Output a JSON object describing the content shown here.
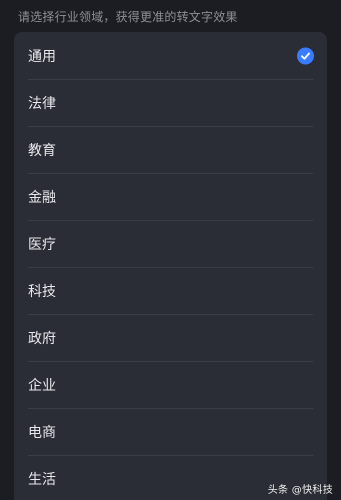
{
  "hint": "请选择行业领域，获得更准的转文字效果",
  "industries": [
    {
      "label": "通用",
      "selected": true
    },
    {
      "label": "法律",
      "selected": false
    },
    {
      "label": "教育",
      "selected": false
    },
    {
      "label": "金融",
      "selected": false
    },
    {
      "label": "医疗",
      "selected": false
    },
    {
      "label": "科技",
      "selected": false
    },
    {
      "label": "政府",
      "selected": false
    },
    {
      "label": "企业",
      "selected": false
    },
    {
      "label": "电商",
      "selected": false
    },
    {
      "label": "生活",
      "selected": false
    }
  ],
  "accent_color": "#3a7cff",
  "check_icon": "check-circle-icon",
  "watermark": "头条 @快科技"
}
